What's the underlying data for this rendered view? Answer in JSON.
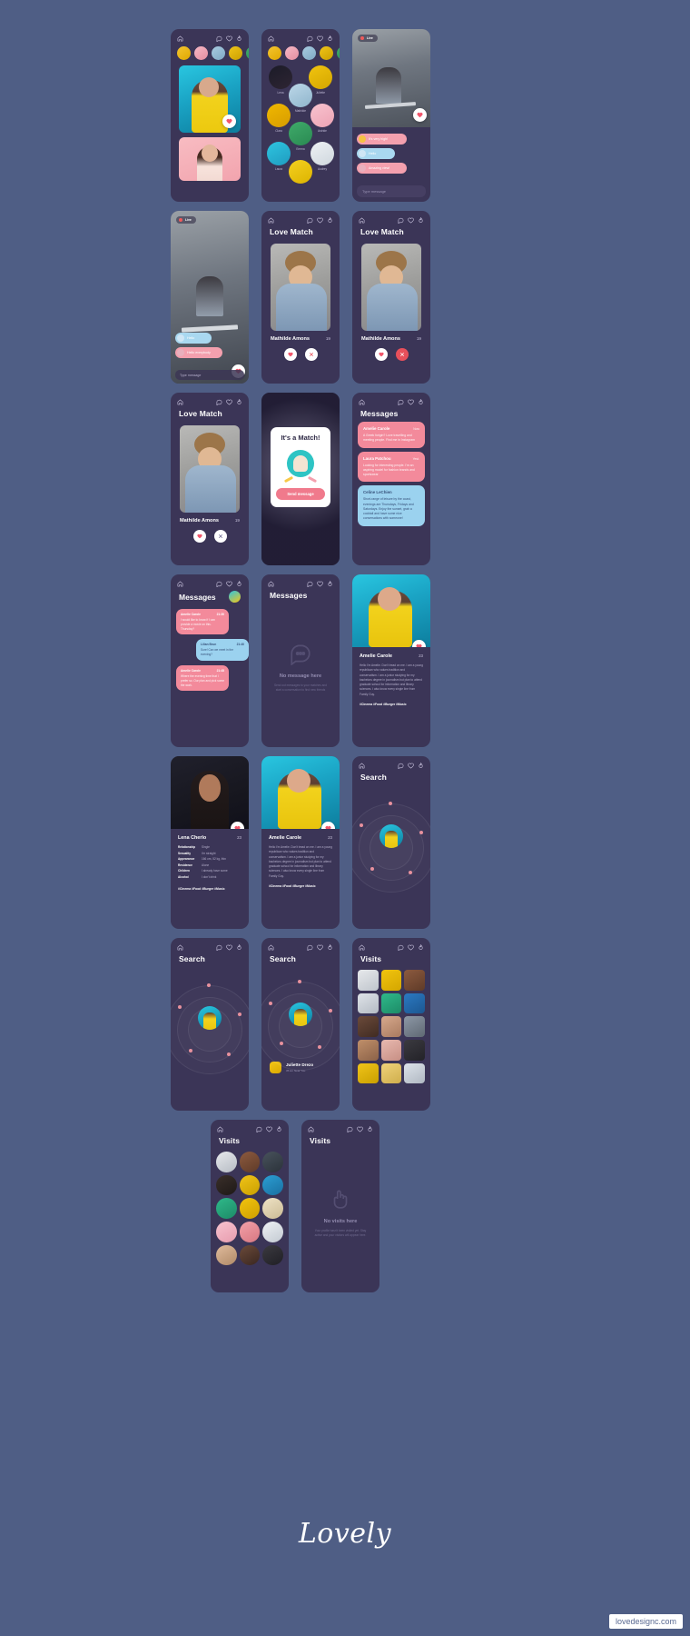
{
  "brand": {
    "logo": "Lovely",
    "watermark": "lovedesignc.com"
  },
  "background_color": "#4f5e85",
  "phone_bg": "#3b3557",
  "accent_pink": "#f38a9b",
  "accent_blue": "#9bd2ef",
  "accent_red": "#e8505b",
  "nav": {
    "home_icon": "home-icon",
    "chat_icon": "chat-bubble-icon",
    "heart_icon": "heart-outline-icon",
    "fire_icon": "flame-icon"
  },
  "screens": {
    "feed": {
      "title": "",
      "stories": [
        "Story 1",
        "Story 2",
        "Story 3",
        "Story 4",
        "Story 5"
      ],
      "like_icon": "heart-filled-icon"
    },
    "people": {
      "names": [
        "Lena",
        "Juliette",
        "Mathilde",
        "Clara",
        "Astride",
        "Emma",
        "Laura",
        "Audrey"
      ]
    },
    "live_chat": {
      "live_label": "Live",
      "messages": [
        {
          "text": "It's very high!",
          "side": "pink"
        },
        {
          "text": "Hello",
          "side": "blue"
        },
        {
          "text": "Amazing view!",
          "side": "pink"
        }
      ],
      "input_placeholder": "Type message"
    },
    "live_chat_2": {
      "live_label": "Live",
      "messages": [
        {
          "text": "Hello",
          "side": "blue"
        },
        {
          "text": "Hello everybody",
          "side": "pink"
        }
      ],
      "input_placeholder": "Type message"
    },
    "love_match": {
      "title": "Love Match",
      "profile_name": "Mathilde Amons",
      "profile_age": "19",
      "like_icon": "heart-filled-icon",
      "dislike_icon": "close-icon"
    },
    "match_modal": {
      "title": "It's a Match!",
      "button_label": "Send message"
    },
    "messages": {
      "title": "Messages",
      "threads": [
        {
          "name": "Amelie Carole",
          "time": "Now",
          "preview": "A Greek forigin? Love travelling and meeting people. Find me in Instagram",
          "color": "pink"
        },
        {
          "name": "Laura Patchou",
          "time": "Yest.",
          "preview": "Looking for interesting people. I'm an aspiring model for fashion brands and sportswear",
          "color": "pink"
        },
        {
          "name": "Celine LeChien",
          "time": "",
          "preview": "Short-range of leisure by the coast, evenings are Thursdays, Fridays and Saturdays. Enjoy the sunset, grab a cocktail and have some nice conversations with someone!",
          "color": "blue"
        }
      ]
    },
    "chat_thread": {
      "title": "Messages",
      "bubbles": [
        {
          "name": "Amelie Carole",
          "time": "21:30",
          "text": "I would like to know if I can provide a movie on this. Thursday?",
          "color": "pink"
        },
        {
          "name": "Lilian Brun",
          "time": "21:40",
          "text": "Sure! Can we meet in the evening?",
          "color": "blue"
        },
        {
          "name": "Amelie Carole",
          "time": "21:45",
          "text": "Where the evening time that I prefer so. Our plan and pick some the work.",
          "color": "pink"
        }
      ]
    },
    "messages_empty": {
      "title": "Messages",
      "empty_title": "No message here",
      "empty_sub": "Send out messages to your matches and start a conversation to find new friends"
    },
    "profile_amelie": {
      "name": "Amelie Carole",
      "age": "23",
      "bio": "Hello I'm Amelie. Don't tread on me. I am a young republican who values tradition and conservatism. I am a junior studying for my bachelors degree in journalism but plan to attend graduate school for information and library sciences. I also know every single line from Family Guy.",
      "tags": "#Cinema #Food #Burger #Music",
      "like_icon": "heart-filled-icon"
    },
    "profile_lena": {
      "name": "Lena Cherlo",
      "age": "23",
      "attributes": [
        {
          "key": "Relationship",
          "value": "Single"
        },
        {
          "key": "Sexuality",
          "value": "I'm straight"
        },
        {
          "key": "Appearance",
          "value": "166 cm, 52 kg, thin"
        },
        {
          "key": "Residence",
          "value": "Alone"
        },
        {
          "key": "Children",
          "value": "I already have some"
        },
        {
          "key": "Alcohol",
          "value": "I don't drink"
        }
      ],
      "tags": "#Cinema #Food #Burger #Music",
      "like_icon": "heart-filled-icon"
    },
    "search": {
      "title": "Search",
      "found_name": "Juliette Drezo",
      "found_sub": "35 km Near You"
    },
    "visits": {
      "title": "Visits"
    },
    "visits_empty": {
      "title": "Visits",
      "empty_title": "No visits here",
      "empty_sub": "Your profile hasn't been visited yet. Stay active and your visitors will appear here."
    }
  }
}
